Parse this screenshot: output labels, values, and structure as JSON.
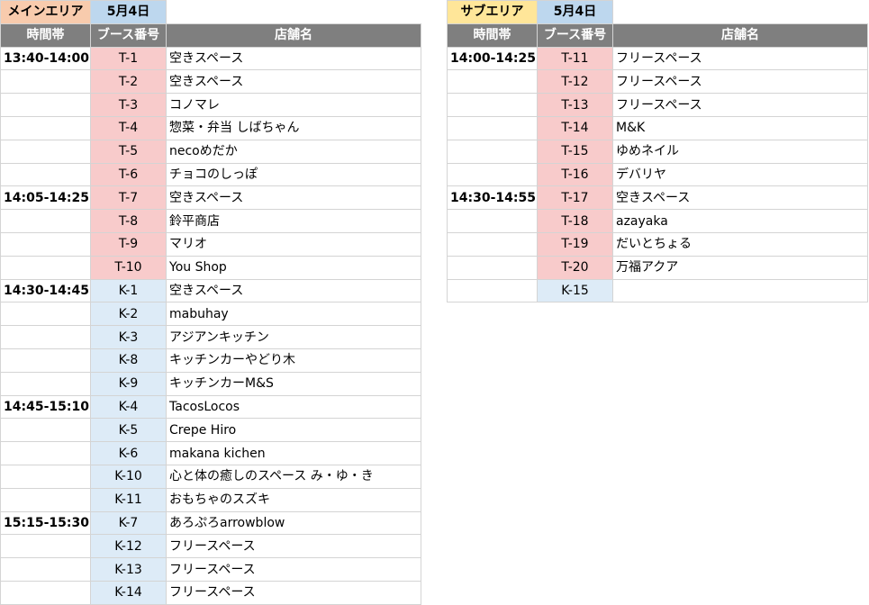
{
  "colors": {
    "main_area_header": "#f8cbad",
    "sub_area_header": "#ffe699",
    "date_header": "#bdd7ee",
    "column_header": "#7f7f7f",
    "booth_t": "#f8cbcb",
    "booth_k": "#ddebf7"
  },
  "main": {
    "area": "メインエリア",
    "date": "5月4日",
    "columns": [
      "時間帯",
      "ブース番号",
      "店舗名"
    ],
    "rows": [
      {
        "time": "13:40-14:00",
        "booth": "T-1",
        "kind": "t",
        "shop": "空きスペース"
      },
      {
        "time": "",
        "booth": "T-2",
        "kind": "t",
        "shop": "空きスペース"
      },
      {
        "time": "",
        "booth": "T-3",
        "kind": "t",
        "shop": "コノマレ"
      },
      {
        "time": "",
        "booth": "T-4",
        "kind": "t",
        "shop": "惣菜・弁当 しばちゃん"
      },
      {
        "time": "",
        "booth": "T-5",
        "kind": "t",
        "shop": "necoめだか"
      },
      {
        "time": "",
        "booth": "T-6",
        "kind": "t",
        "shop": "チョコのしっぽ"
      },
      {
        "time": "14:05-14:25",
        "booth": "T-7",
        "kind": "t",
        "shop": "空きスペース"
      },
      {
        "time": "",
        "booth": "T-8",
        "kind": "t",
        "shop": "鈴平商店"
      },
      {
        "time": "",
        "booth": "T-9",
        "kind": "t",
        "shop": "マリオ"
      },
      {
        "time": "",
        "booth": "T-10",
        "kind": "t",
        "shop": "You Shop"
      },
      {
        "time": "14:30-14:45",
        "booth": "K-1",
        "kind": "k",
        "shop": "空きスペース"
      },
      {
        "time": "",
        "booth": "K-2",
        "kind": "k",
        "shop": "mabuhay"
      },
      {
        "time": "",
        "booth": "K-3",
        "kind": "k",
        "shop": "アジアンキッチン"
      },
      {
        "time": "",
        "booth": "K-8",
        "kind": "k",
        "shop": "キッチンカーやどり木"
      },
      {
        "time": "",
        "booth": "K-9",
        "kind": "k",
        "shop": "キッチンカーM&S"
      },
      {
        "time": "14:45-15:10",
        "booth": "K-4",
        "kind": "k",
        "shop": "TacosLocos"
      },
      {
        "time": "",
        "booth": "K-5",
        "kind": "k",
        "shop": "Crepe Hiro"
      },
      {
        "time": "",
        "booth": "K-6",
        "kind": "k",
        "shop": "makana kichen"
      },
      {
        "time": "",
        "booth": "K-10",
        "kind": "k",
        "shop": "心と体の癒しのスペース み・ゆ・き"
      },
      {
        "time": "",
        "booth": "K-11",
        "kind": "k",
        "shop": "おもちゃのスズキ"
      },
      {
        "time": "15:15-15:30",
        "booth": "K-7",
        "kind": "k",
        "shop": "あろぷろarrowblow"
      },
      {
        "time": "",
        "booth": "K-12",
        "kind": "k",
        "shop": "フリースペース"
      },
      {
        "time": "",
        "booth": "K-13",
        "kind": "k",
        "shop": "フリースペース"
      },
      {
        "time": "",
        "booth": "K-14",
        "kind": "k",
        "shop": "フリースペース"
      }
    ]
  },
  "sub": {
    "area": "サブエリア",
    "date": "5月4日",
    "columns": [
      "時間帯",
      "ブース番号",
      "店舗名"
    ],
    "rows": [
      {
        "time": "14:00-14:25",
        "booth": "T-11",
        "kind": "t",
        "shop": "フリースペース"
      },
      {
        "time": "",
        "booth": "T-12",
        "kind": "t",
        "shop": "フリースペース"
      },
      {
        "time": "",
        "booth": "T-13",
        "kind": "t",
        "shop": "フリースペース"
      },
      {
        "time": "",
        "booth": "T-14",
        "kind": "t",
        "shop": "M&K"
      },
      {
        "time": "",
        "booth": "T-15",
        "kind": "t",
        "shop": "ゆめネイル"
      },
      {
        "time": "",
        "booth": "T-16",
        "kind": "t",
        "shop": "デバリヤ"
      },
      {
        "time": "14:30-14:55",
        "booth": "T-17",
        "kind": "t",
        "shop": "空きスペース"
      },
      {
        "time": "",
        "booth": "T-18",
        "kind": "t",
        "shop": "azayaka"
      },
      {
        "time": "",
        "booth": "T-19",
        "kind": "t",
        "shop": "だいとちょる"
      },
      {
        "time": "",
        "booth": "T-20",
        "kind": "t",
        "shop": "万福アクア"
      },
      {
        "time": "",
        "booth": "K-15",
        "kind": "k",
        "shop": ""
      }
    ]
  }
}
